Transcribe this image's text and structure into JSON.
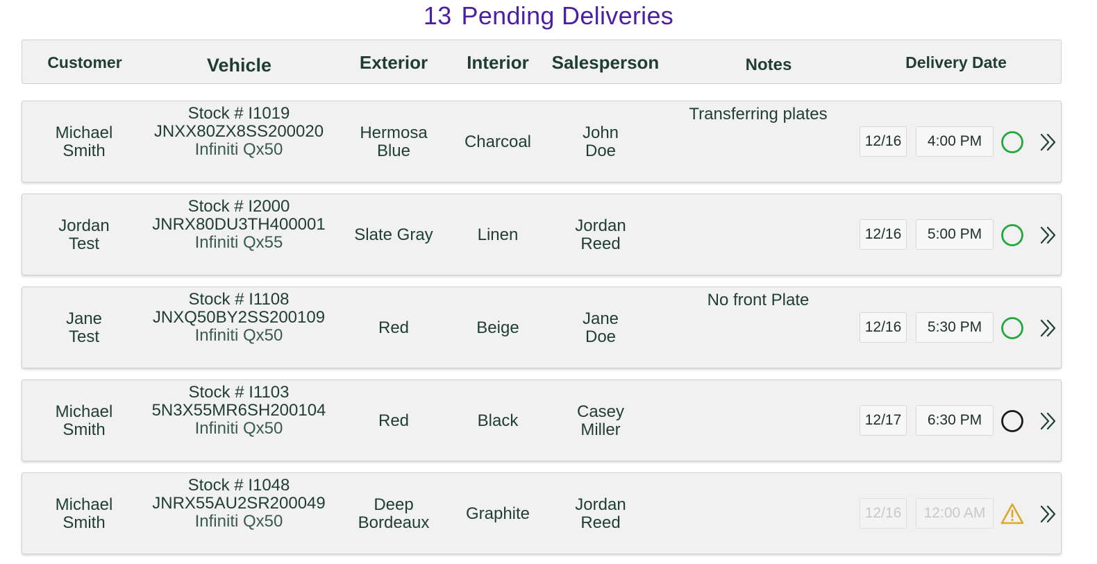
{
  "title": {
    "count": "13",
    "text": "Pending Deliveries"
  },
  "columns": {
    "customer": "Customer",
    "vehicle": "Vehicle",
    "exterior": "Exterior",
    "interior": "Interior",
    "salesperson": "Salesperson",
    "notes": "Notes",
    "delivery_date": "Delivery Date"
  },
  "colors": {
    "title": "#4b1fa3",
    "text": "#1f3d33",
    "status_ok": "#22a83a",
    "status_pending": "#1a1a1a",
    "status_warning": "#e0a526"
  },
  "rows": [
    {
      "customer": [
        "Michael",
        "Smith"
      ],
      "stock": "Stock # I1019",
      "vin": "JNXX80ZX8SS200020",
      "model": "Infiniti Qx50",
      "exterior": [
        "Hermosa",
        "Blue"
      ],
      "interior": [
        "Charcoal"
      ],
      "salesperson": [
        "John",
        "Doe"
      ],
      "notes": "Transferring plates",
      "date": "12/16",
      "time": "4:00 PM",
      "status_icon": "green-circle-icon",
      "disabled": false
    },
    {
      "customer": [
        "Jordan",
        "Test"
      ],
      "stock": "Stock # I2000",
      "vin": "JNRX80DU3TH400001",
      "model": "Infiniti Qx55",
      "exterior": [
        "Slate Gray"
      ],
      "interior": [
        "Linen"
      ],
      "salesperson": [
        "Jordan",
        "Reed"
      ],
      "notes": "",
      "date": "12/16",
      "time": "5:00 PM",
      "status_icon": "green-circle-icon",
      "disabled": false
    },
    {
      "customer": [
        "Jane",
        "Test"
      ],
      "stock": "Stock # I1108",
      "vin": "JNXQ50BY2SS200109",
      "model": "Infiniti Qx50",
      "exterior": [
        "Red"
      ],
      "interior": [
        "Beige"
      ],
      "salesperson": [
        "Jane",
        "Doe"
      ],
      "notes": "No front Plate",
      "date": "12/16",
      "time": "5:30 PM",
      "status_icon": "green-circle-icon",
      "disabled": false
    },
    {
      "customer": [
        "Michael",
        "Smith"
      ],
      "stock": "Stock # I1103",
      "vin": "5N3X55MR6SH200104",
      "model": "Infiniti Qx50",
      "exterior": [
        "Red"
      ],
      "interior": [
        "Black"
      ],
      "salesperson": [
        "Casey",
        "Miller"
      ],
      "notes": "",
      "date": "12/17",
      "time": "6:30 PM",
      "status_icon": "black-circle-icon",
      "disabled": false
    },
    {
      "customer": [
        "Michael",
        "Smith"
      ],
      "stock": "Stock # I1048",
      "vin": "JNRX55AU2SR200049",
      "model": "Infiniti Qx50",
      "exterior": [
        "Deep",
        "Bordeaux"
      ],
      "interior": [
        "Graphite"
      ],
      "salesperson": [
        "Jordan",
        "Reed"
      ],
      "notes": "",
      "date": "12/16",
      "time": "12:00 AM",
      "status_icon": "warning-triangle-icon",
      "disabled": true
    }
  ]
}
